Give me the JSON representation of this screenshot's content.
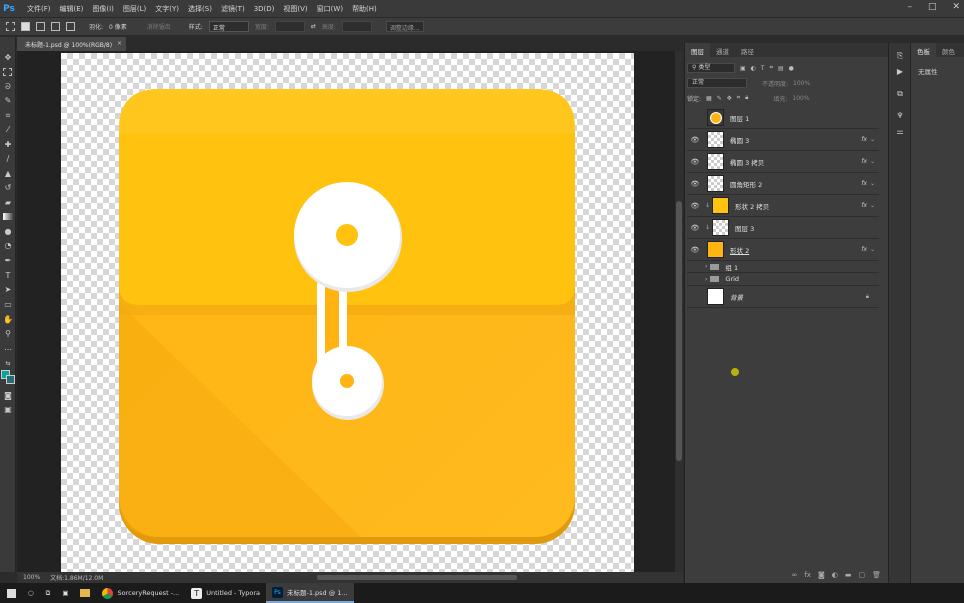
{
  "app": {
    "logo": "Ps"
  },
  "menu": [
    "文件(F)",
    "编辑(E)",
    "图像(I)",
    "图层(L)",
    "文字(Y)",
    "选择(S)",
    "滤镜(T)",
    "3D(D)",
    "视图(V)",
    "窗口(W)",
    "帮助(H)"
  ],
  "window_controls": [
    "–",
    "□",
    "✕"
  ],
  "options_bar": {
    "feather_label": "羽化:",
    "feather_value": "0 像素",
    "antialias": "消除锯齿",
    "style_label": "样式:",
    "style_value": "正常",
    "width_label": "宽度:",
    "height_label": "高度:",
    "refine_edge": "调整边缘..."
  },
  "document_tab": {
    "title": "未标题-1.psd @ 100%(RGB/8)",
    "close": "×"
  },
  "status_bar": {
    "zoom": "100%",
    "doc_info": "文档:1.86M/12.0M"
  },
  "layers_panel": {
    "tabs": [
      "图层",
      "通道",
      "路径"
    ],
    "filter_type": "类型",
    "blend_mode": "正常",
    "opacity_label": "不透明度:",
    "opacity_value": "100%",
    "lock_label": "锁定:",
    "fill_label": "填充:",
    "fill_value": "100%",
    "layers": [
      {
        "name": "图层 1",
        "visible": false,
        "fx": "",
        "thumb": "orange-circle"
      },
      {
        "name": "椭圆 3",
        "visible": true,
        "fx": "fx",
        "thumb": "checker"
      },
      {
        "name": "椭圆 3 拷贝",
        "visible": true,
        "fx": "fx",
        "thumb": "checker"
      },
      {
        "name": "圆角矩形 2",
        "visible": true,
        "fx": "fx",
        "thumb": "checker"
      },
      {
        "name": "形状 2 拷贝",
        "visible": true,
        "fx": "fx",
        "thumb": "yellow"
      },
      {
        "name": "图层 3",
        "visible": true,
        "fx": "",
        "thumb": "checker"
      },
      {
        "name": "形状 2",
        "visible": true,
        "fx": "fx",
        "thumb": "orange"
      },
      {
        "name": "组 1",
        "visible": false,
        "fx": "",
        "thumb": "folder"
      },
      {
        "name": "Grid",
        "visible": false,
        "fx": "",
        "thumb": "folder"
      },
      {
        "name": "背景",
        "visible": false,
        "fx": "",
        "thumb": "white"
      }
    ]
  },
  "properties_panel": {
    "tabs": [
      "色板",
      "颜色"
    ],
    "content": "无属性"
  },
  "taskbar": [
    {
      "label": "SorceryRequest -...",
      "active": false
    },
    {
      "label": "Untitled - Typora",
      "active": false
    },
    {
      "label": "未标题-1.psd @ 1...",
      "active": true
    }
  ],
  "colors": {
    "envelope_top": "#ffc20e",
    "envelope_body": "#ffb412",
    "envelope_shadow": "#e8a20d",
    "button": "#ffffff",
    "ps_blue": "#31a8ff"
  }
}
